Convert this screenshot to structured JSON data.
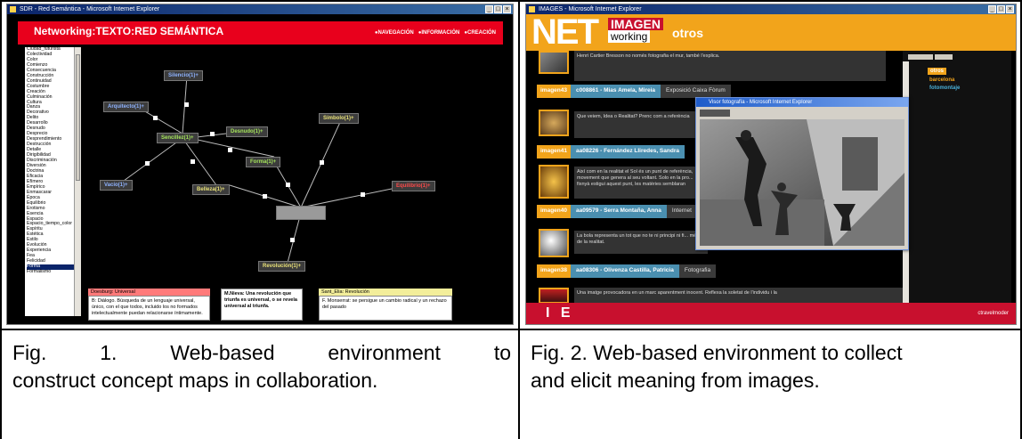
{
  "figures": [
    {
      "caption": "Fig.   1.   Web-based   environment   to construct concept maps in collaboration.",
      "caption_lines": [
        "Fig.   1.   Web-based   environment   to",
        "construct concept maps in collaboration."
      ],
      "screenshot": {
        "window_title": "SDR - Red Semántica - Microsoft Internet Explorer",
        "window_controls": [
          "_",
          "□",
          "×"
        ],
        "header_title": "Networking:TEXTO:RED SEMÁNTICA",
        "nav_options": [
          "NAVEGACIÓN",
          "INFORMACIÓN",
          "CREACIÓN"
        ],
        "word_list": [
          "Ciudad_futurista",
          "Colectividad",
          "Color",
          "Comienzo",
          "Consecuencia",
          "Construcción",
          "Continuidad",
          "Costumbre",
          "Creación",
          "Culminación",
          "Cultura",
          "Danza",
          "Decorativo",
          "Delito",
          "Desarrollo",
          "Desnudo",
          "Desprecio",
          "Desprendimiento",
          "Destrucción",
          "Detalle",
          "Dirigibilidad",
          "Discriminación",
          "Diversión",
          "Doctrina",
          "Eficacia",
          "Efímero",
          "Empírico",
          "Enmascarar",
          "Época",
          "Equilibrio",
          "Erotismo",
          "Esencia",
          "Espacio",
          "Espacio_tiempo_color",
          "Espíritu",
          "Estética",
          "Estilo",
          "Evolución",
          "Experiencia",
          "Fea",
          "Felicidad",
          "Forma",
          "Formalismo"
        ],
        "selected_word": "Forma",
        "nodes": [
          {
            "label": "Silencio(1)+",
            "color": "blue"
          },
          {
            "label": "Arquitecto(1)+",
            "color": "blue"
          },
          {
            "label": "Sencillez(1)+",
            "color": "green"
          },
          {
            "label": "Desnudo(1)+",
            "color": "green"
          },
          {
            "label": "Símbolo(1)+",
            "color": "yellow"
          },
          {
            "label": "Forma(1)+",
            "color": "green"
          },
          {
            "label": "Vacío(1)+",
            "color": "blue"
          },
          {
            "label": "Belleza(1)+",
            "color": "yellow"
          },
          {
            "label": "Equilibrio(1)+",
            "color": "red"
          },
          {
            "label": "Revolución(1)+",
            "color": "yellow"
          },
          {
            "label": "",
            "color": "center"
          }
        ],
        "info_boxes": [
          {
            "header": "Doesburg: Universal",
            "body": "B: Diálogo. Búsqueda de un lenguaje universal, único, con el que todos, incluido los no formados intelectualmente puedan relacionarse íntimamente."
          },
          {
            "header": "",
            "body": "M.Nieva: Una revolución que triunfa es universal, o se revela universal al triunfa."
          },
          {
            "header": "Sant_Elia: Revolución",
            "body": "F. Monserrat: se persigue un cambio radical y un rechazo del pasado"
          }
        ]
      }
    },
    {
      "caption": "Fig. 2. Web-based environment to collect and elicit meaning from images.",
      "caption_lines": [
        "Fig. 2. Web-based environment to collect",
        "and elicit meaning from images."
      ],
      "screenshot": {
        "window_title": "IMAGES - Microsoft Internet Explorer",
        "logo_net": "NET",
        "logo_imagen": "IMAGEN",
        "logo_working": "working",
        "logo_otros": "otros",
        "entries": [
          {
            "text": "Henri Cartier Bresson no només fotografia el mur, també l'explica.",
            "tag": "",
            "name": "",
            "extra": ""
          },
          {
            "text": "Que veiem, Idea o Realitat? Prenc com a referència",
            "tag": "imagen43",
            "name": "c008861 - Mias Amela, Mireia",
            "extra": "Exposició Caixa Fòrum"
          },
          {
            "text": "Així com en la realitat el Sol és un punt de referència, movement que genera al seu voltant. Solo en la pro... fixnyà estigui aquest punt, les matèries semblaran",
            "tag": "imagen41",
            "name": "aa08226 - Fernández Lliredes, Sandra",
            "extra": ""
          },
          {
            "text": "La bola representa un tot que no te ni principi ni fi... més de la realitat.",
            "tag": "imagen40",
            "name": "aa09579 - Serra Montaña, Anna",
            "extra": "Internet"
          },
          {
            "text": "Una imatge provocadora en un marc aparentment inocent. Reflexa la soletat de l'individu i la",
            "tag": "imagen38",
            "name": "aa08306 - Olivenza Castilla, Patricia",
            "extra": "Fotografia"
          }
        ],
        "popup_title": "Visor fotografía - Microsoft Internet Explorer",
        "side_items": [
          "otros",
          "barcelona",
          "fotomontaje"
        ],
        "footer_logo": "I E",
        "footer_text": "ctravelmoder"
      }
    }
  ]
}
